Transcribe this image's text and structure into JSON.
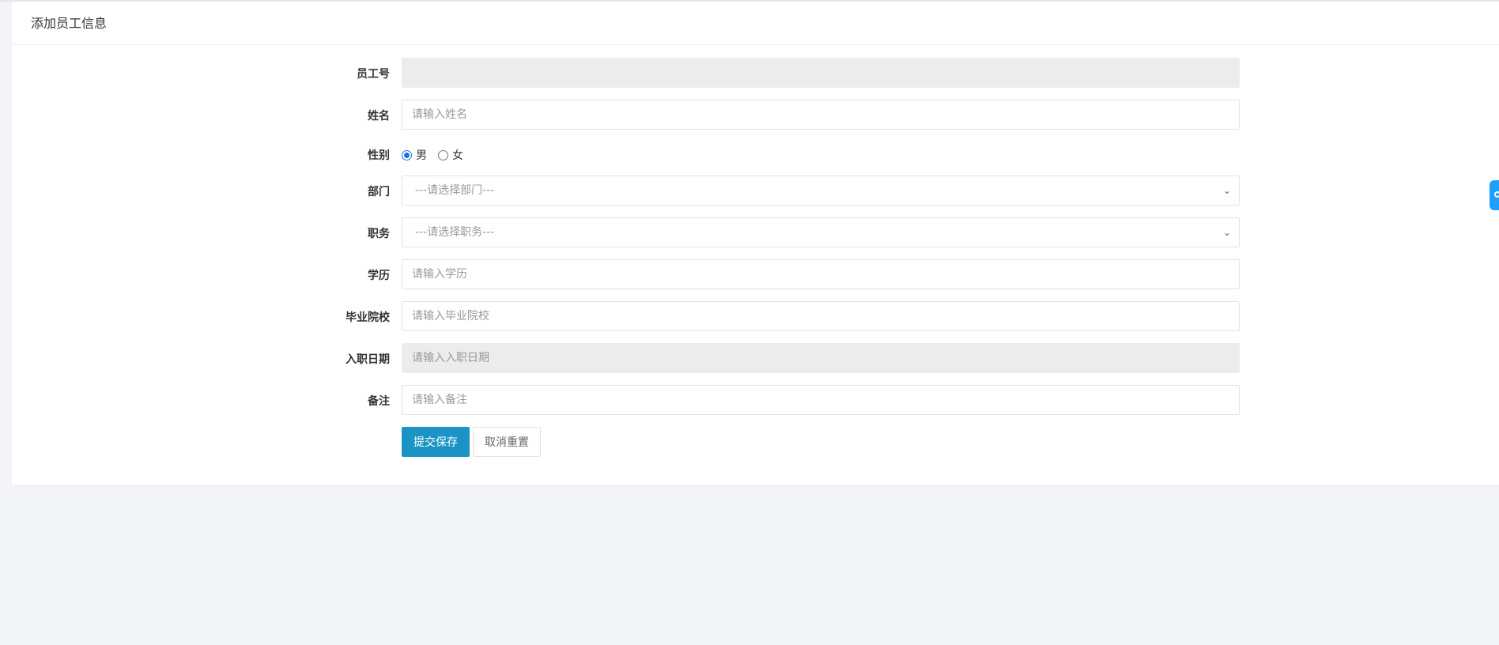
{
  "panel": {
    "title": "添加员工信息"
  },
  "form": {
    "employee_no": {
      "label": "员工号",
      "value": "",
      "placeholder": ""
    },
    "name": {
      "label": "姓名",
      "value": "",
      "placeholder": "请输入姓名"
    },
    "gender": {
      "label": "性别",
      "options": [
        {
          "label": "男",
          "checked": true
        },
        {
          "label": "女",
          "checked": false
        }
      ]
    },
    "department": {
      "label": "部门",
      "selected": "---请选择部门---"
    },
    "position": {
      "label": "职务",
      "selected": "---请选择职务---"
    },
    "education": {
      "label": "学历",
      "value": "",
      "placeholder": "请输入学历"
    },
    "school": {
      "label": "毕业院校",
      "value": "",
      "placeholder": "请输入毕业院校"
    },
    "hire_date": {
      "label": "入职日期",
      "value": "",
      "placeholder": "请输入入职日期"
    },
    "remark": {
      "label": "备注",
      "value": "",
      "placeholder": "请输入备注"
    }
  },
  "buttons": {
    "submit": "提交保存",
    "reset": "取消重置"
  },
  "colors": {
    "primary": "#1a94c4",
    "radio_accent": "#1a73e8",
    "side_tab": "#1e9fff",
    "readonly_bg": "#ececec"
  },
  "icons": {
    "select_arrow": "chevron-down-icon",
    "side_tab": "settings-tab-icon"
  }
}
